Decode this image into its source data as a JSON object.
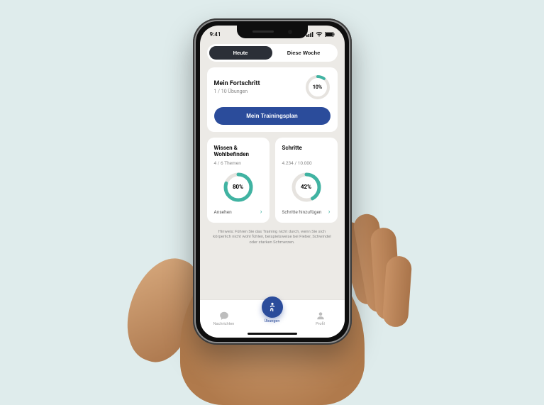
{
  "status": {
    "time": "9:41"
  },
  "tabs": {
    "today": "Heute",
    "week": "Diese Woche"
  },
  "progress": {
    "title": "Mein Fortschritt",
    "subtitle": "1 / 10 Übungen",
    "percent": 10,
    "percent_label": "10%",
    "cta": "Mein Trainingsplan"
  },
  "knowledge": {
    "title": "Wissen & Wohlbefinden",
    "subtitle": "4 / 6 Themen",
    "percent": 80,
    "percent_label": "80%",
    "action": "Ansehen"
  },
  "steps": {
    "title": "Schritte",
    "subtitle": "4.234 / 10.000",
    "percent": 42,
    "percent_label": "42%",
    "action": "Schritte hinzufügen"
  },
  "hint": "Hinweis: Führen Sie das Training nicht durch, wenn Sie sich körperlich nicht wohl fühlen, beispielsweise bei Fieber, Schwindel oder starken Schmerzen.",
  "nav": {
    "messages": "Nachrichten",
    "exercises": "Übungen",
    "profile": "Profil"
  },
  "colors": {
    "accent": "#2b4c9b",
    "ring": "#40b3a2"
  }
}
